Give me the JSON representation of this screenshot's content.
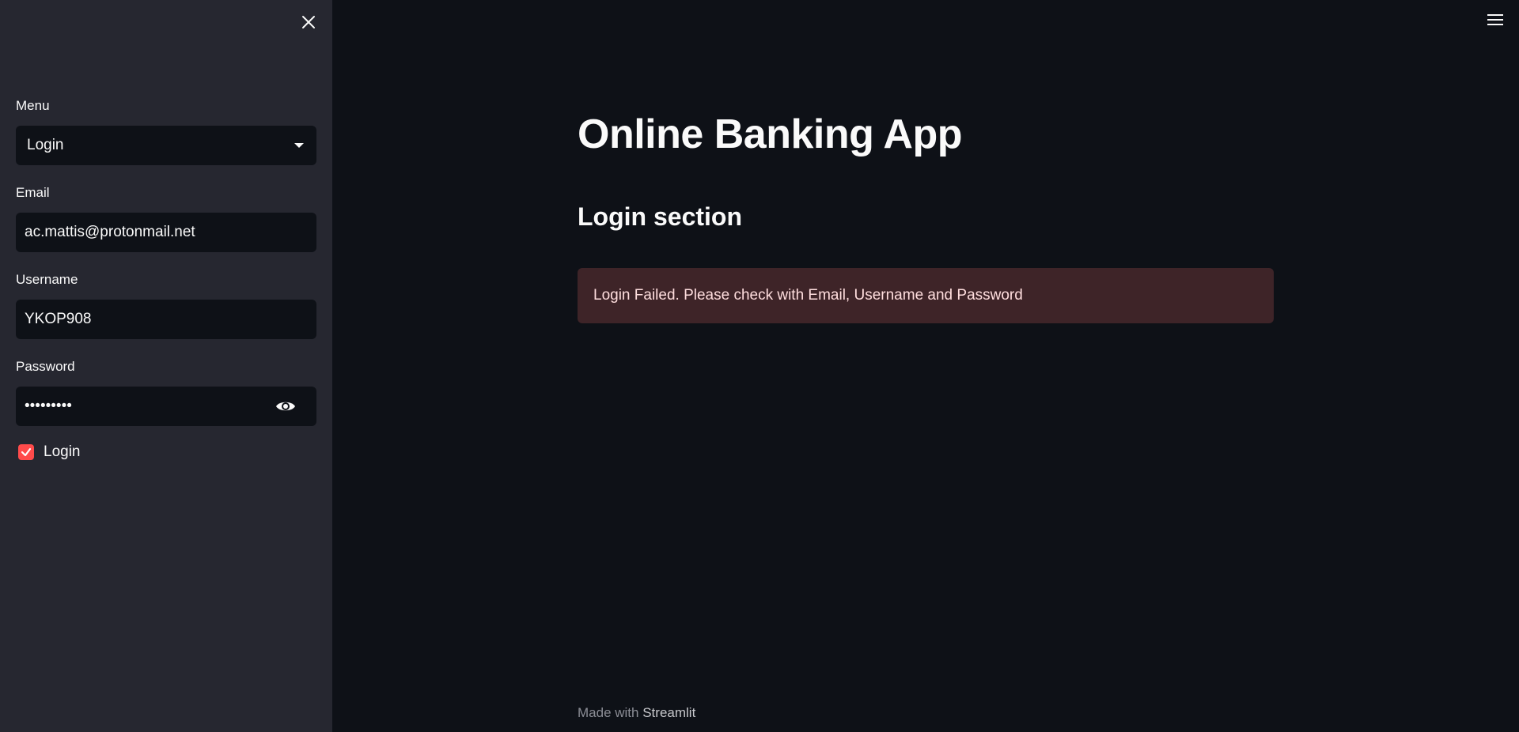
{
  "sidebar": {
    "menu_label": "Menu",
    "menu_selected": "Login",
    "email_label": "Email",
    "email_value": "ac.mattis@protonmail.net",
    "username_label": "Username",
    "username_value": "YKOP908",
    "password_label": "Password",
    "password_value": "•••••••••",
    "checkbox_label": "Login",
    "checkbox_checked": true
  },
  "main": {
    "title": "Online Banking App",
    "section_title": "Login section",
    "error_message": "Login Failed. Please check with Email, Username and Password"
  },
  "footer": {
    "made_with": "Made with",
    "brand": "Streamlit"
  },
  "icons": {
    "close": "close-icon",
    "menu": "hamburger-icon",
    "eye": "eye-icon",
    "dropdown": "chevron-down-icon",
    "check": "check-icon"
  },
  "colors": {
    "sidebar_bg": "#262730",
    "main_bg": "#0e1117",
    "accent": "#ff4b4b",
    "error_bg": "#3e2428",
    "error_text": "#ffdede"
  }
}
